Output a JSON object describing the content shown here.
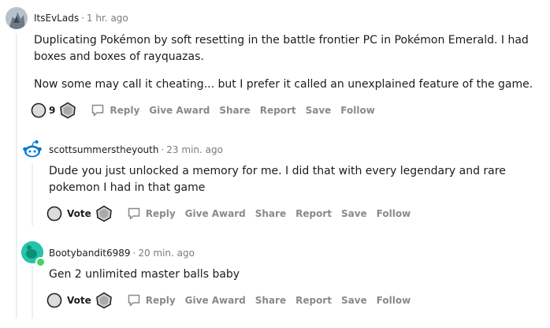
{
  "comments": [
    {
      "username": "ItsEvLads",
      "time": "1 hr. ago",
      "paragraphs": [
        "Duplicating Pokémon by soft resetting in the battle frontier PC in Pokémon Emerald. I had boxes and boxes of rayquazas.",
        "Now some may call it cheating... but I prefer it called an unexplained feature of the game."
      ],
      "vote_label": "9",
      "actions": {
        "reply": "Reply",
        "award": "Give Award",
        "share": "Share",
        "report": "Report",
        "save": "Save",
        "follow": "Follow"
      }
    },
    {
      "username": "scottsummerstheyouth",
      "time": "23 min. ago",
      "paragraphs": [
        "Dude you just unlocked a memory for me. I did that with every legendary and rare pokemon I had in that game"
      ],
      "vote_label": "Vote",
      "actions": {
        "reply": "Reply",
        "award": "Give Award",
        "share": "Share",
        "report": "Report",
        "save": "Save",
        "follow": "Follow"
      }
    },
    {
      "username": "Bootybandit6989",
      "time": "20 min. ago",
      "paragraphs": [
        "Gen 2 unlimited master balls baby"
      ],
      "vote_label": "Vote",
      "actions": {
        "reply": "Reply",
        "award": "Give Award",
        "share": "Share",
        "report": "Report",
        "save": "Save",
        "follow": "Follow"
      }
    }
  ],
  "separator": "·",
  "colors": {
    "meta_gray": "#7c7c7c",
    "action_gray": "#878a8c",
    "thread_line": "#edeff1",
    "online_green": "#46d160",
    "snoo_blue": "#0079d3"
  }
}
